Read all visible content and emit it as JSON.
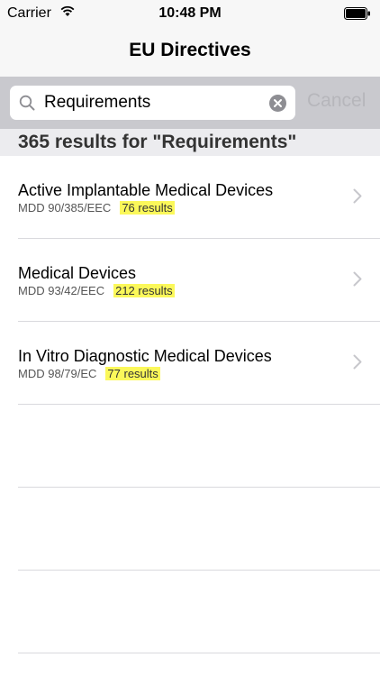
{
  "status": {
    "carrier": "Carrier",
    "time": "10:48 PM"
  },
  "nav": {
    "title": "EU Directives"
  },
  "search": {
    "value": "Requirements",
    "cancel_label": "Cancel"
  },
  "results": {
    "count_label": "365 results for \"Requirements\"",
    "items": [
      {
        "title": "Active Implantable Medical Devices",
        "code": "MDD 90/385/EEC",
        "count": "76 results"
      },
      {
        "title": "Medical Devices",
        "code": "MDD 93/42/EEC",
        "count": "212 results"
      },
      {
        "title": "In Vitro Diagnostic Medical Devices",
        "code": "MDD 98/79/EC",
        "count": "77 results"
      }
    ]
  },
  "colors": {
    "highlight": "#fbf85a",
    "search_bar_bg": "#c9c9ce",
    "cancel_disabled": "#b6b6bb"
  }
}
